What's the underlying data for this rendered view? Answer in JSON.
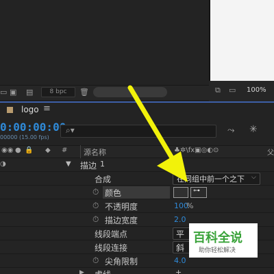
{
  "project": {
    "bpc_label": "8 bpc",
    "zoom_level": "100%"
  },
  "timeline": {
    "comp_name": "logo",
    "menu_glyph": "≡",
    "timecode": "0:00:00:00",
    "frame_info": "00000 (15.00 fps)",
    "search_glyph": "⌕"
  },
  "columns": {
    "hash": "#",
    "source_name": "源名称",
    "switches": "♣✲\\fx▣◎◐⊙",
    "parent_fragment": "父"
  },
  "layers": {
    "stroke_group": {
      "name": "描边",
      "index": "1"
    },
    "composite": {
      "label": "合成",
      "value": "在同组中前一个之下"
    },
    "color": {
      "label": "颜色"
    },
    "opacity": {
      "label": "不透明度",
      "value": "100",
      "unit": "%"
    },
    "stroke_width": {
      "label": "描边宽度",
      "value": "2.0"
    },
    "line_cap": {
      "label": "线段端点",
      "value": "平"
    },
    "line_join": {
      "label": "线段连接",
      "value": "斜"
    },
    "miter_limit": {
      "label": "尖角限制",
      "value": "4.0"
    },
    "dashes": {
      "label": "虚线"
    }
  },
  "watermark": {
    "title": "百科全说",
    "subtitle": "助你轻松解决"
  },
  "colors": {
    "accent_blue": "#2f8ad8",
    "arrow_yellow": "#f2f20a",
    "watermark_green": "#3aa33a"
  }
}
